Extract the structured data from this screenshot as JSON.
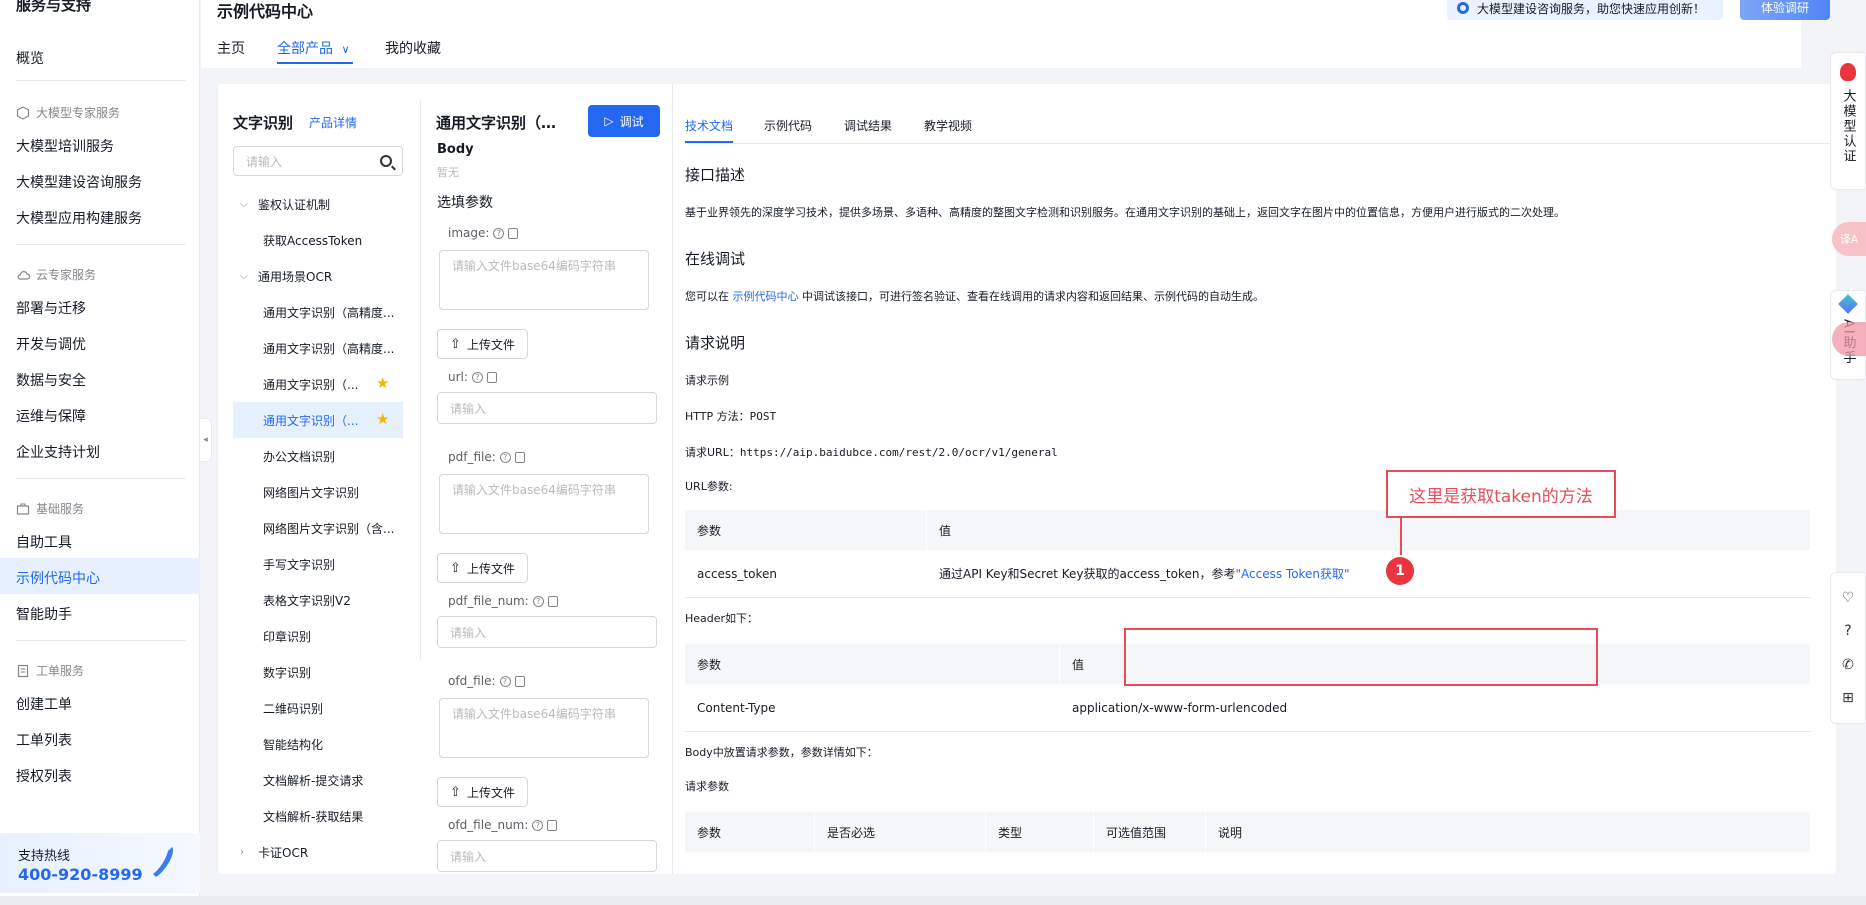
{
  "sidebar": {
    "top_title": "服务与支持",
    "overview": "概览",
    "sections": [
      {
        "title": "大模型专家服务",
        "items": [
          "大模型培训服务",
          "大模型建设咨询服务",
          "大模型应用构建服务"
        ]
      },
      {
        "title": "云专家服务",
        "items": [
          "部署与迁移",
          "开发与调优",
          "数据与安全",
          "运维与保障",
          "企业支持计划"
        ]
      },
      {
        "title": "基础服务",
        "items": [
          "自助工具",
          "示例代码中心",
          "智能助手"
        ]
      },
      {
        "title": "工单服务",
        "items": [
          "创建工单",
          "工单列表",
          "授权列表"
        ]
      }
    ],
    "hotline_label": "支持热线",
    "hotline_number": "400-920-8999"
  },
  "header": {
    "title": "示例代码中心",
    "tabs": [
      "主页",
      "全部产品",
      "我的收藏"
    ],
    "notice": "大模型建设咨询服务，助您快速应用创新！",
    "survey": "体验调研"
  },
  "product": {
    "title": "文字识别",
    "detail_link": "产品详情",
    "search_placeholder": "请输入",
    "tree": [
      {
        "kind": "group",
        "label": "鉴权认证机制",
        "caret": "⌵"
      },
      {
        "kind": "item",
        "label": "获取AccessToken"
      },
      {
        "kind": "group",
        "label": "通用场景OCR",
        "caret": "⌵"
      },
      {
        "kind": "item",
        "label": "通用文字识别（高精度..."
      },
      {
        "kind": "item",
        "label": "通用文字识别（高精度..."
      },
      {
        "kind": "item",
        "label": "通用文字识别（..."
      },
      {
        "kind": "item",
        "label": "通用文字识别（..."
      },
      {
        "kind": "item",
        "label": "办公文档识别"
      },
      {
        "kind": "item",
        "label": "网络图片文字识别"
      },
      {
        "kind": "item",
        "label": "网络图片文字识别（含..."
      },
      {
        "kind": "item",
        "label": "手写文字识别"
      },
      {
        "kind": "item",
        "label": "表格文字识别V2"
      },
      {
        "kind": "item",
        "label": "印章识别"
      },
      {
        "kind": "item",
        "label": "数字识别"
      },
      {
        "kind": "item",
        "label": "二维码识别"
      },
      {
        "kind": "item",
        "label": "智能结构化"
      },
      {
        "kind": "item",
        "label": "文档解析-提交请求"
      },
      {
        "kind": "item",
        "label": "文档解析-获取结果"
      },
      {
        "kind": "group",
        "label": "卡证OCR",
        "caret": "›"
      }
    ]
  },
  "params": {
    "api_title": "通用文字识别（…",
    "debug_button": "调试",
    "body_label": "Body",
    "none_label": "暂无",
    "optional_label": "选填参数",
    "image_label": "image:",
    "image_placeholder": "请输入文件base64编码字符串",
    "upload_label": "上传文件",
    "url_label": "url:",
    "url_placeholder": "请输入",
    "pdf_label": "pdf_file:",
    "pdf_placeholder": "请输入文件base64编码字符串",
    "pdf_num_label": "pdf_file_num:",
    "pdf_num_placeholder": "请输入",
    "ofd_label": "ofd_file:",
    "ofd_placeholder": "请输入文件base64编码字符串",
    "ofd_num_label": "ofd_file_num:",
    "ofd_num_placeholder": "请输入"
  },
  "doc": {
    "tabs": [
      "技术文档",
      "示例代码",
      "调试结果",
      "教学视频"
    ],
    "h_interface": "接口描述",
    "interface_desc": "基于业界领先的深度学习技术，提供多场景、多语种、高精度的整图文字检测和识别服务。在通用文字识别的基础上，返回文字在图片中的位置信息，方便用户进行版式的二次处理。",
    "h_online": "在线调试",
    "online_pre": "您可以在 ",
    "online_link": "示例代码中心",
    "online_post": " 中调试该接口，可进行签名验证、查看在线调用的请求内容和返回结果、示例代码的自动生成。",
    "h_request": "请求说明",
    "request_example": "请求示例",
    "http_method_label": "HTTP 方法：",
    "http_method": "POST",
    "request_url_label": "请求URL：",
    "request_url": "https://aip.baidubce.com/rest/2.0/ocr/v1/general",
    "url_params_label": "URL参数:",
    "table1": {
      "headers": [
        "参数",
        "值"
      ],
      "row": {
        "param": "access_token",
        "value_pre": "通过API Key和Secret Key获取的access_token，参考",
        "value_link": "\"Access Token获取\""
      }
    },
    "header_label": "Header如下：",
    "table2": {
      "headers": [
        "参数",
        "值"
      ],
      "row": [
        "Content-Type",
        "application/x-www-form-urlencoded"
      ]
    },
    "body_label": "Body中放置请求参数，参数详情如下：",
    "req_params_label": "请求参数",
    "table3": {
      "headers": [
        "参数",
        "是否必选",
        "类型",
        "可选值范围",
        "说明"
      ]
    }
  },
  "annotation": {
    "text": "这里是获取taken的方法",
    "badge": "1"
  },
  "right_float": {
    "cert": "大模型认证",
    "ai": "AI助手",
    "translate": "译A",
    "tools": [
      "♡",
      "?",
      "✆",
      "⊞"
    ]
  }
}
